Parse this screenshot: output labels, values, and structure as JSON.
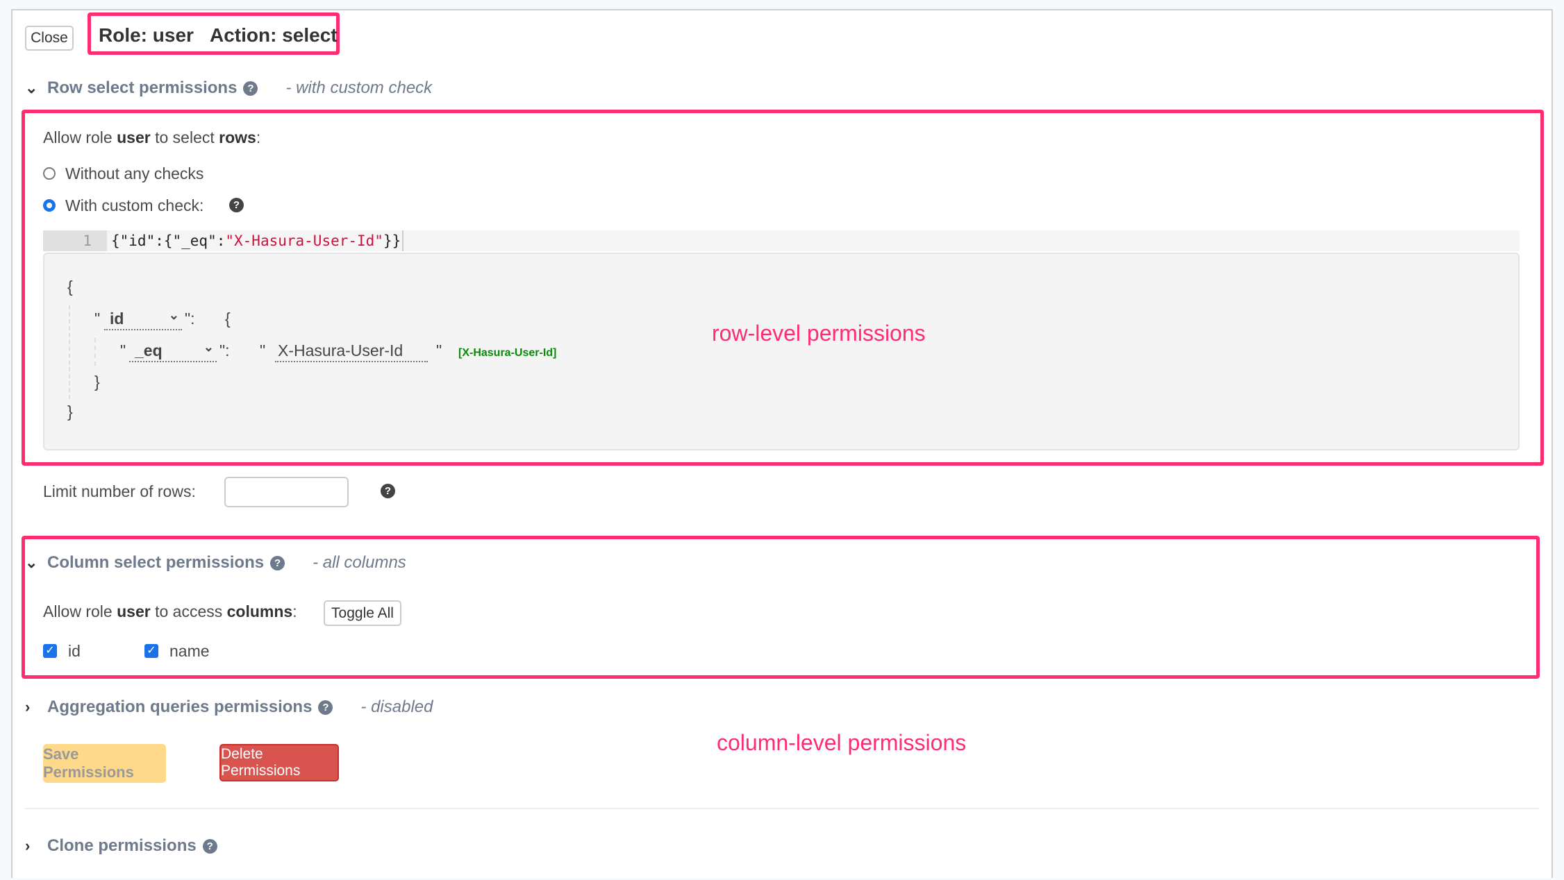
{
  "header": {
    "close_label": "Close",
    "role_label": "Role: user",
    "action_label": "Action: select"
  },
  "row_section": {
    "title": "Row select permissions",
    "subtitle": "- with custom check",
    "expanded": true,
    "allow_prefix": "Allow role ",
    "allow_role": "user",
    "allow_mid": " to select ",
    "allow_target": "rows",
    "allow_suffix": ":",
    "options": [
      {
        "label": "Without any checks",
        "selected": false
      },
      {
        "label": "With custom check:",
        "selected": true
      }
    ],
    "code_editor": {
      "line_number": "1",
      "code_prefix": "{\"id\":{\"_eq\":",
      "code_string": "\"X-Hasura-User-Id\"",
      "code_suffix": "}}"
    },
    "builder": {
      "open_brace": "{",
      "close_brace": "}",
      "field_select": "id",
      "operator_select": "_eq",
      "quote": "\"",
      "colon": "\":",
      "value": "X-Hasura-User-Id",
      "value_hint": "[X-Hasura-User-Id]"
    },
    "limit_label": "Limit number of rows:",
    "limit_value": ""
  },
  "column_section": {
    "title": "Column select permissions",
    "subtitle": "- all columns",
    "expanded": true,
    "allow_prefix": "Allow role ",
    "allow_role": "user",
    "allow_mid": " to access ",
    "allow_target": "columns",
    "allow_suffix": ":",
    "toggle_all_label": "Toggle All",
    "columns": [
      {
        "name": "id",
        "checked": true
      },
      {
        "name": "name",
        "checked": true
      }
    ]
  },
  "aggregation_section": {
    "title": "Aggregation queries permissions",
    "subtitle": "- disabled",
    "expanded": false
  },
  "actions": {
    "save_label": "Save Permissions",
    "delete_label": "Delete Permissions"
  },
  "clone_section": {
    "title": "Clone permissions",
    "expanded": false
  },
  "annotations": {
    "row_level": "row-level permissions",
    "column_level": "column-level permissions",
    "highlight_color": "#ff2d6f"
  },
  "colors": {
    "primary_blue": "#1a73e8",
    "save_yellow": "#ffd98a",
    "delete_red": "#d9534f",
    "section_title": "#6d7a8c",
    "session_var_green": "#0a8a0a",
    "code_string": "#d0103a"
  }
}
